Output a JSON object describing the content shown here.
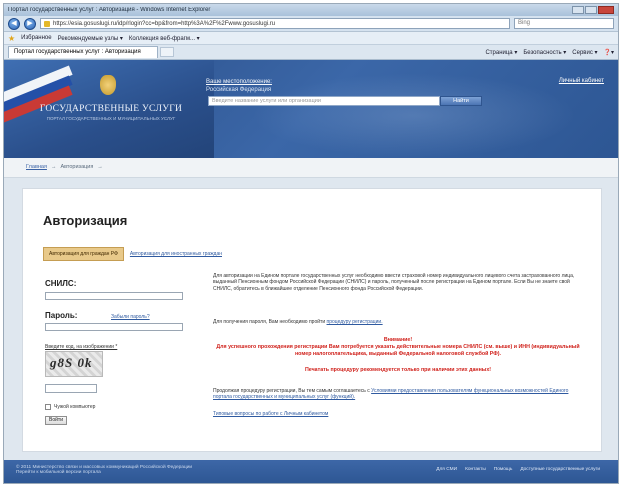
{
  "window": {
    "title": "Портал государственных услуг : Авторизация - Windows Internet Explorer"
  },
  "browser": {
    "address": "https://esia.gosuslugi.ru/idp/rlogin?cc=bp&from=http%3A%2F%2Fwww.gosuslugi.ru",
    "search_placeholder": "Bing",
    "favorites_label": "Избранное",
    "fav_items": [
      "Рекомендуемые узлы ▾",
      "Коллекция веб-фрагм... ▾"
    ],
    "tab_title": "Портал государственных услуг : Авторизация",
    "tools": [
      "Страница ▾",
      "Безопасность ▾",
      "Сервис ▾",
      "❓▾"
    ]
  },
  "header": {
    "brand": "ГОСУДАРСТВЕННЫЕ УСЛУГИ",
    "brand_sub": "ПОРТАЛ ГОСУДАРСТВЕННЫХ И МУНИЦИПАЛЬНЫХ УСЛУГ",
    "location_label": "Ваше местоположение:",
    "location_value": "Российская Федерация",
    "search_placeholder": "Введите название услуги или организации",
    "search_button": "Найти",
    "login_link": "Личный кабинет"
  },
  "breadcrumb": {
    "home": "Главная",
    "current": "Авторизация"
  },
  "auth": {
    "title": "Авторизация",
    "tab_active": "Авторизация для граждан РФ",
    "tab_other": "Авторизация для иностранных граждан",
    "snils_label": "СНИЛС:",
    "password_label": "Пароль:",
    "forgot_link": "Забыли пароль?",
    "captcha_label": "Введите код, на изображении *",
    "captcha_text": "g8S 0k",
    "remember_label": "Чужой компьютер",
    "login_button": "Войти"
  },
  "info": {
    "p1": "Для авторизации на Едином портале государственных услуг необходимо ввести страховой номер индивидуального лицевого счета застрахованного лица, выданный Пенсионным фондом Российской Федерации (СНИЛС) и пароль, полученный после регистрации на Едином портале. Если Вы не знаете свой СНИЛС, обратитесь в ближайшее отделение Пенсионного фонда Российской Федерации.",
    "p2_prefix": "Для получения пароля, Вам необходимо пройти",
    "p2_link": "процедуру регистрации.",
    "warn_title": "Внимание!",
    "warn_text": "Для успешного прохождения регистрации Вам потребуется указать действительные номера СНИЛС (см. выше) и ИНН (индивидуальный номер налогоплательщика, выданный Федеральной налоговой службой РФ).",
    "warn2": "Печатать процедуру рекомендуется только при наличии этих данных!",
    "p3_prefix": "Продолжая процедуру регистрации, Вы тем самым соглашаетесь с",
    "p3_link": "Условиями предоставления пользователям функциональных возможностей Единого портала государственных и муниципальных услуг (функций).",
    "p4_link": "Типовые вопросы по работе с Личным кабинетом"
  },
  "footer": {
    "copy": "© 2011 Министерство связи и массовых коммуникаций Российской Федерации",
    "copy2": "Перейти к мобильной версии портала",
    "links": [
      "Для СМИ",
      "Контакты",
      "Помощь",
      "Доступные государственные услуги"
    ]
  }
}
